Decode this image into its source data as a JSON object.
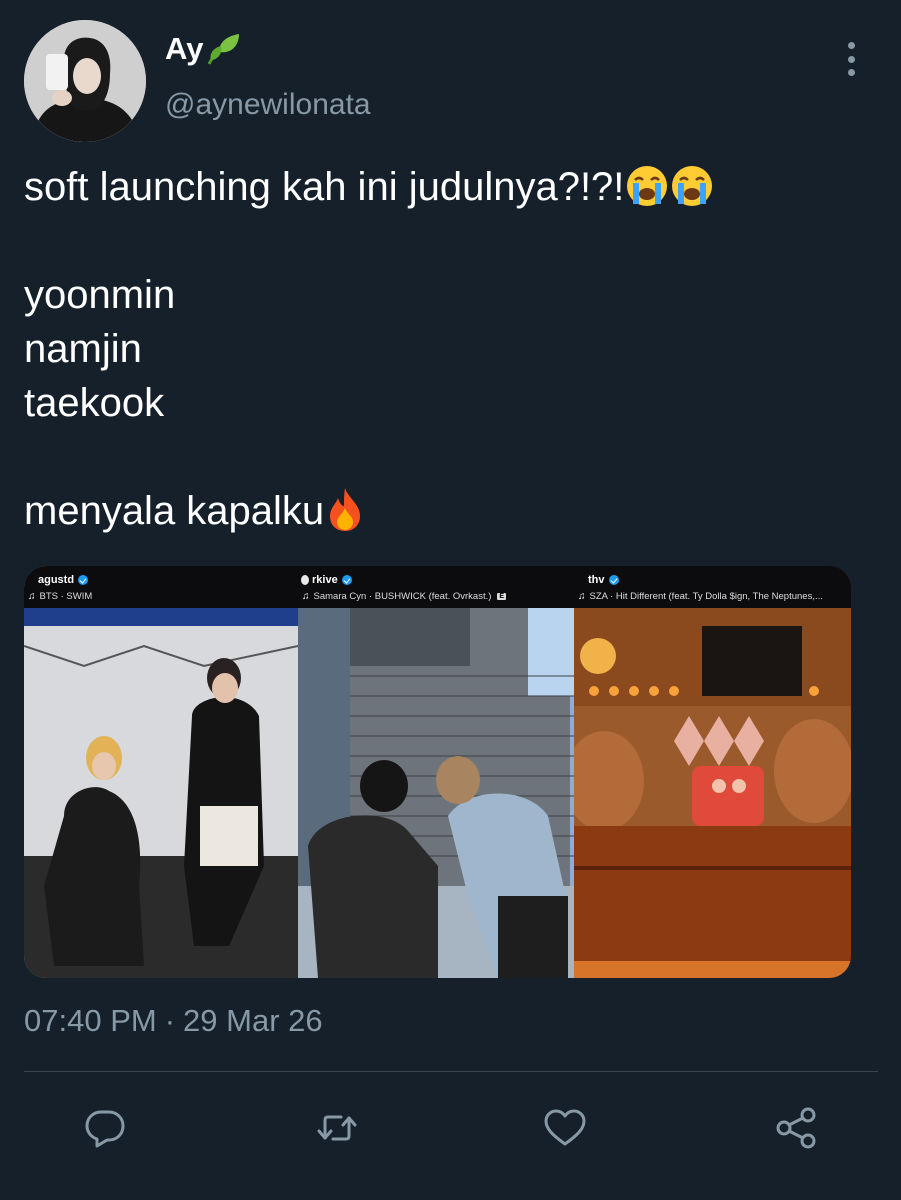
{
  "user": {
    "display_name": "Ay",
    "name_emoji": "leaf-icon",
    "handle": "@aynewilonata"
  },
  "tweet": {
    "line1": "soft launching kah ini judulnya?!?!",
    "line1_emojis": [
      "loudly-crying-face-icon",
      "loudly-crying-face-icon"
    ],
    "ships": [
      "yoonmin",
      "namjin",
      "taekook"
    ],
    "closing": "menyala kapalku",
    "closing_emoji": "fire-icon"
  },
  "media": {
    "panels": [
      {
        "username": "agustd",
        "song": "BTS · SWIM",
        "explicit": false
      },
      {
        "username": "rkive",
        "song": "Samara Cyn · BUSHWICK (feat. Ovrkast.)",
        "explicit": true,
        "explicit_label": "E"
      },
      {
        "username": "thv",
        "song": "SZA · Hit Different (feat. Ty Dolla $ign, The Neptunes,...",
        "explicit": false
      }
    ]
  },
  "timestamp": {
    "time": "07:40 PM",
    "separator": "·",
    "date": "29 Mar 26"
  },
  "actions": [
    "reply-icon",
    "retweet-icon",
    "like-icon",
    "share-icon"
  ],
  "colors": {
    "background": "#15202b",
    "secondary_text": "#8899a6",
    "divider": "#38444d",
    "verified": "#1d9bf0"
  }
}
